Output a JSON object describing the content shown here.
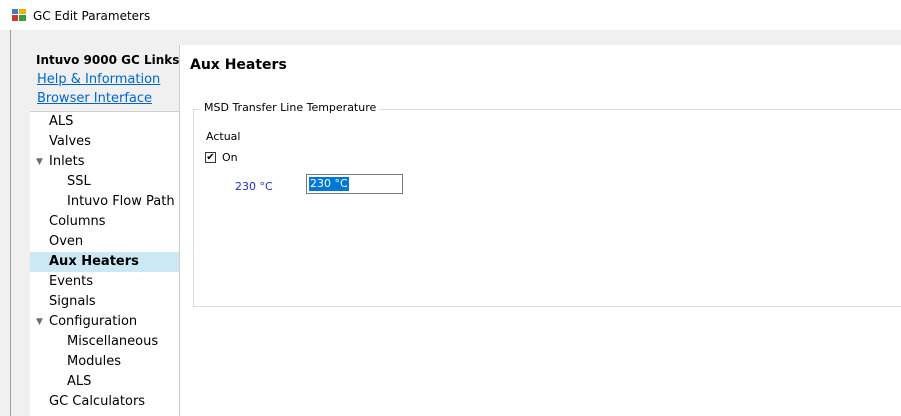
{
  "window": {
    "title": "GC Edit Parameters"
  },
  "sidebar": {
    "header": "Intuvo 9000 GC Links",
    "links": [
      "Help & Information",
      "Browser Interface"
    ],
    "items": [
      {
        "label": "ALS",
        "level": 0
      },
      {
        "label": "Valves",
        "level": 0
      },
      {
        "label": "Inlets",
        "level": 0,
        "expanded": true
      },
      {
        "label": "SSL",
        "level": 1
      },
      {
        "label": "Intuvo Flow Path",
        "level": 1
      },
      {
        "label": "Columns",
        "level": 0
      },
      {
        "label": "Oven",
        "level": 0
      },
      {
        "label": "Aux Heaters",
        "level": 0,
        "selected": true
      },
      {
        "label": "Events",
        "level": 0
      },
      {
        "label": "Signals",
        "level": 0
      },
      {
        "label": "Configuration",
        "level": 0,
        "expanded": true
      },
      {
        "label": "Miscellaneous",
        "level": 1
      },
      {
        "label": "Modules",
        "level": 1
      },
      {
        "label": "ALS",
        "level": 1
      },
      {
        "label": "GC Calculators",
        "level": 0
      }
    ]
  },
  "main": {
    "title": "Aux Heaters",
    "group": {
      "legend": "MSD Transfer Line Temperature",
      "actual_label": "Actual",
      "checkbox": {
        "label": "On",
        "checked": true
      },
      "actual_value": "230 °C",
      "setpoint_value": "230 °C"
    }
  },
  "colors": {
    "selection_bg": "#cce8f4",
    "link": "#0066cc",
    "actual_value": "#1f2fd0",
    "input_highlight": "#0078d7"
  }
}
